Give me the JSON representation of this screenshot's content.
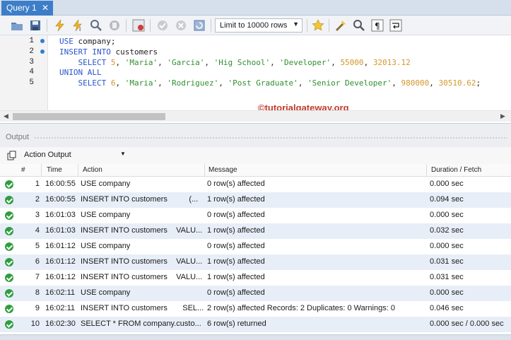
{
  "tab": {
    "title": "Query 1",
    "close": "✕"
  },
  "toolbar": {
    "limit_value": "Limit to 10000 rows",
    "icons": [
      "open-folder-icon",
      "save-icon",
      "execute-icon",
      "execute-current-icon",
      "explain-icon",
      "stop-icon",
      "toggle-results-icon",
      "commit-icon",
      "rollback-icon",
      "autocommit-icon",
      "limit-select",
      "beautify-icon",
      "find-icon",
      "invisible-chars-icon",
      "wrap-icon"
    ]
  },
  "editor": {
    "lines": [
      {
        "n": "1",
        "dot": true
      },
      {
        "n": "2",
        "dot": true
      },
      {
        "n": "3",
        "dot": false
      },
      {
        "n": "4",
        "dot": false
      },
      {
        "n": "5",
        "dot": false
      }
    ]
  },
  "watermark": "©tutorialgateway.org",
  "output": {
    "label": "Output",
    "selector": "Action Output",
    "headers": {
      "num": "#",
      "time": "Time",
      "action": "Action",
      "message": "Message",
      "duration": "Duration / Fetch"
    },
    "rows": [
      {
        "n": "1",
        "time": "16:00:55",
        "action": "USE company",
        "message": "0 row(s) affected",
        "duration": "0.000 sec"
      },
      {
        "n": "2",
        "time": "16:00:55",
        "action": "INSERT INTO customers          (...",
        "message": "1 row(s) affected",
        "duration": "0.094 sec"
      },
      {
        "n": "3",
        "time": "16:01:03",
        "action": "USE company",
        "message": "0 row(s) affected",
        "duration": "0.000 sec"
      },
      {
        "n": "4",
        "time": "16:01:03",
        "action": "INSERT INTO customers    VALU...",
        "message": "1 row(s) affected",
        "duration": "0.032 sec"
      },
      {
        "n": "5",
        "time": "16:01:12",
        "action": "USE company",
        "message": "0 row(s) affected",
        "duration": "0.000 sec"
      },
      {
        "n": "6",
        "time": "16:01:12",
        "action": "INSERT INTO customers    VALU...",
        "message": "1 row(s) affected",
        "duration": "0.031 sec"
      },
      {
        "n": "7",
        "time": "16:01:12",
        "action": "INSERT INTO customers    VALU...",
        "message": "1 row(s) affected",
        "duration": "0.031 sec"
      },
      {
        "n": "8",
        "time": "16:02:11",
        "action": "USE company",
        "message": "0 row(s) affected",
        "duration": "0.000 sec"
      },
      {
        "n": "9",
        "time": "16:02:11",
        "action": "INSERT INTO customers       SEL...",
        "message": "2 row(s) affected Records: 2  Duplicates: 0  Warnings: 0",
        "duration": "0.046 sec"
      },
      {
        "n": "10",
        "time": "16:02:30",
        "action": "SELECT * FROM company.custo...",
        "message": "6 row(s) returned",
        "duration": "0.000 sec / 0.000 sec"
      }
    ]
  }
}
